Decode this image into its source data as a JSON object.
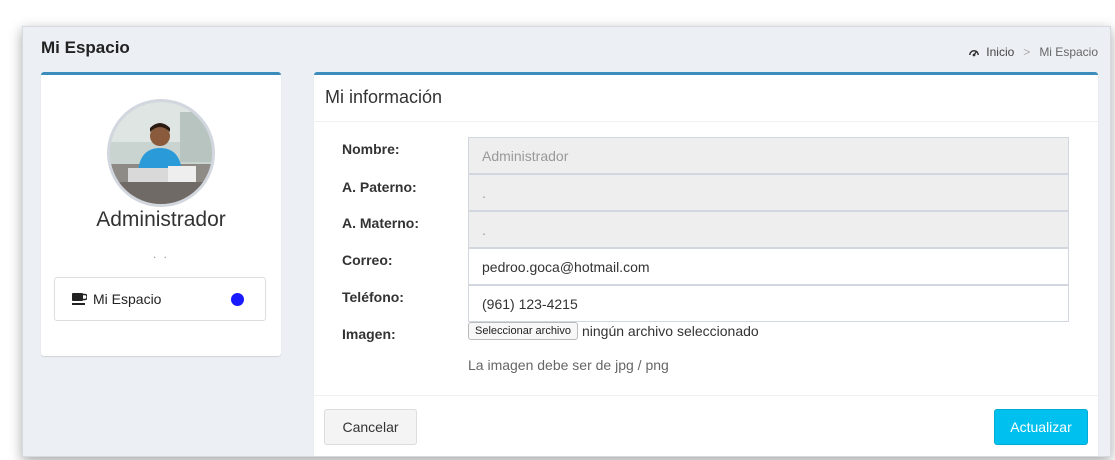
{
  "header": {
    "title": "Mi Espacio",
    "breadcrumb": {
      "home": "Inicio",
      "separator": ">",
      "current": "Mi Espacio"
    }
  },
  "profile": {
    "name": "Administrador",
    "subtitle": ". .",
    "nav_item": {
      "label": "Mi Espacio",
      "icon": "coffee-cup-icon",
      "dot_color": "#1a1aff"
    }
  },
  "form": {
    "title": "Mi información",
    "fields": [
      {
        "label": "Nombre:",
        "value": "Administrador",
        "disabled": true
      },
      {
        "label": "A. Paterno:",
        "value": ".",
        "disabled": true
      },
      {
        "label": "A. Materno:",
        "value": ".",
        "disabled": true
      },
      {
        "label": "Correo:",
        "value": "pedroo.goca@hotmail.com",
        "disabled": false
      },
      {
        "label": "Teléfono:",
        "value": "(961) 123-4215",
        "disabled": false
      }
    ],
    "image": {
      "label": "Imagen:",
      "button": "Seleccionar archivo",
      "status": "ningún archivo seleccionado",
      "help": "La imagen debe ser de jpg / png"
    },
    "buttons": {
      "cancel": "Cancelar",
      "submit": "Actualizar"
    }
  },
  "colors": {
    "accent": "#3c8dbc",
    "submit": "#00c0ef"
  }
}
